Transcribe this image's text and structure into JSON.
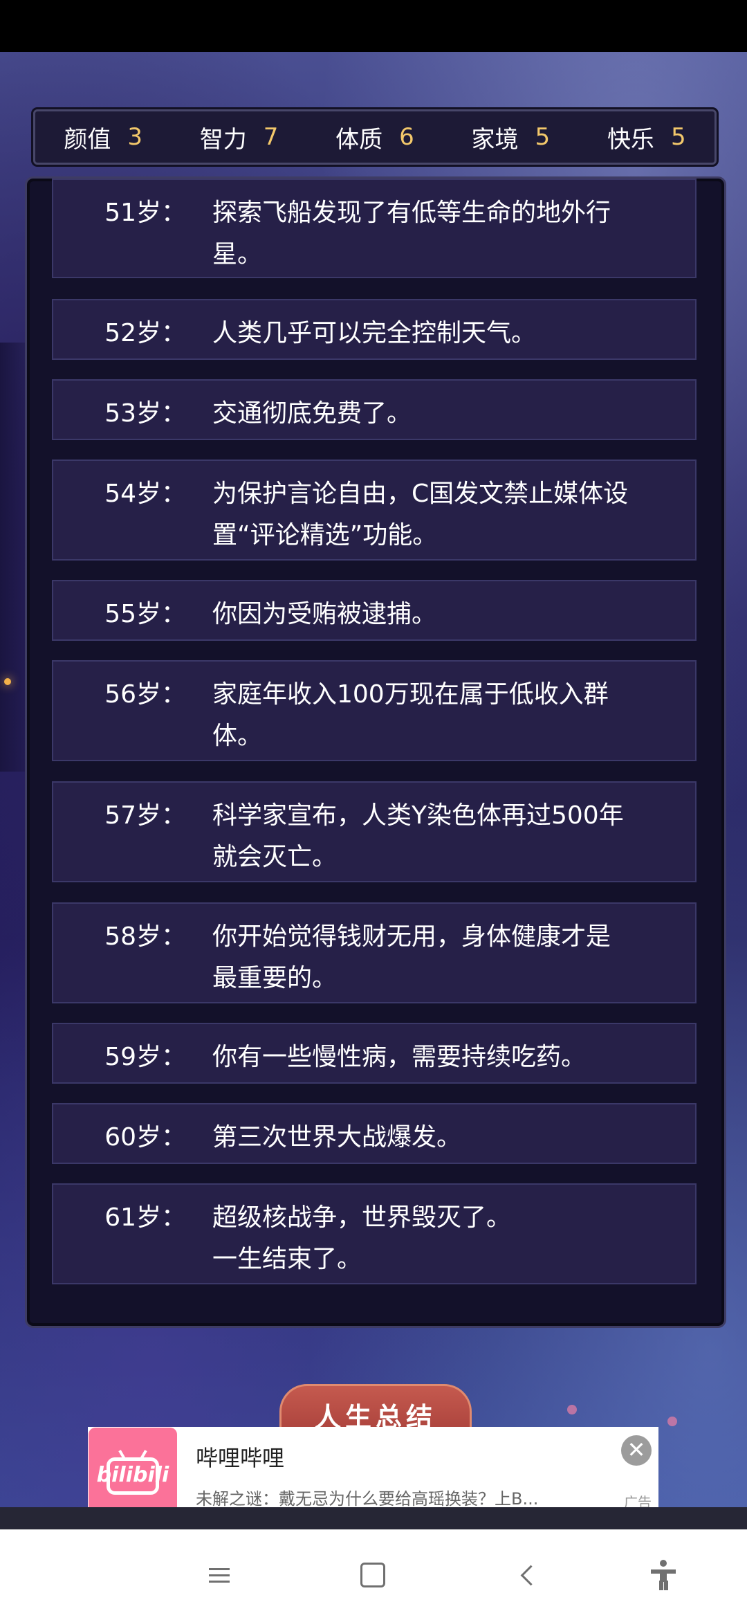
{
  "stats": [
    {
      "label": "颜值",
      "value": "3"
    },
    {
      "label": "智力",
      "value": "7"
    },
    {
      "label": "体质",
      "value": "6"
    },
    {
      "label": "家境",
      "value": "5"
    },
    {
      "label": "快乐",
      "value": "5"
    }
  ],
  "events": [
    {
      "age": "51岁：",
      "text": "探索飞船发现了有低等生命的地外行\n星。"
    },
    {
      "age": "52岁：",
      "text": "人类几乎可以完全控制天气。"
    },
    {
      "age": "53岁：",
      "text": "交通彻底免费了。"
    },
    {
      "age": "54岁：",
      "text": "为保护言论自由，C国发文禁止媒体设\n置“评论精选”功能。"
    },
    {
      "age": "55岁：",
      "text": "你因为受贿被逮捕。"
    },
    {
      "age": "56岁：",
      "text": "家庭年收入100万现在属于低收入群\n体。"
    },
    {
      "age": "57岁：",
      "text": "科学家宣布，人类Y染色体再过500年\n就会灭亡。"
    },
    {
      "age": "58岁：",
      "text": "你开始觉得钱财无用，身体健康才是\n最重要的。"
    },
    {
      "age": "59岁：",
      "text": "你有一些慢性病，需要持续吃药。"
    },
    {
      "age": "60岁：",
      "text": "第三次世界大战爆发。"
    },
    {
      "age": "61岁：",
      "text": "超级核战争，世界毁灭了。\n一生结束了。"
    }
  ],
  "summary_button": "人生总结",
  "ad": {
    "logo_text": "bilibili",
    "title": "哔哩哔哩",
    "description": "未解之谜：戴无忌为什么要给高瑶换装？上B...",
    "tag": "广告",
    "close": "✕"
  },
  "icons": {
    "nav": [
      "menu-icon",
      "home-icon",
      "back-icon",
      "accessibility-icon"
    ]
  },
  "colors": {
    "stat_value": "#f3c86b",
    "event_bg": "#262048",
    "summary_button": "#a33b36",
    "brand_pink": "#fb7299"
  }
}
